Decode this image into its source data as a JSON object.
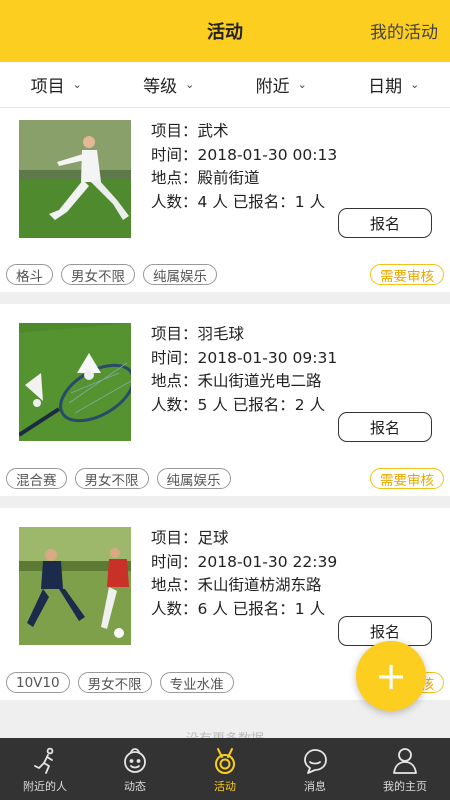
{
  "header": {
    "title": "活动",
    "my_activity": "我的活动"
  },
  "filters": [
    "项目",
    "等级",
    "附近",
    "日期"
  ],
  "info_labels": {
    "project": "项目：",
    "time": "时间：",
    "place": "地点：",
    "people": "人数：",
    "people_unit": " 人",
    "signed": " 已报名："
  },
  "signup_label": "报名",
  "review_label": "需要审核",
  "activities": [
    {
      "project": "武术",
      "time": "2018-01-30 00:13",
      "place": "殿前街道",
      "count": "4",
      "signed": "1",
      "tags": [
        "格斗",
        "男女不限",
        "纯属娱乐"
      ]
    },
    {
      "project": "羽毛球",
      "time": "2018-01-30 09:31",
      "place": "禾山街道光电二路",
      "count": "5",
      "signed": "2",
      "tags": [
        "混合赛",
        "男女不限",
        "纯属娱乐"
      ]
    },
    {
      "project": "足球",
      "time": "2018-01-30 22:39",
      "place": "禾山街道枋湖东路",
      "count": "6",
      "signed": "1",
      "tags": [
        "10V10",
        "男女不限",
        "专业水准"
      ]
    }
  ],
  "no_more": "没有更多数据",
  "fab": "+",
  "tabs": [
    {
      "label": "附近的人",
      "icon": "runner-icon"
    },
    {
      "label": "动态",
      "icon": "face-icon"
    },
    {
      "label": "活动",
      "icon": "medal-icon",
      "active": true
    },
    {
      "label": "消息",
      "icon": "chat-bubble-icon"
    },
    {
      "label": "我的主页",
      "icon": "person-icon"
    }
  ],
  "colors": {
    "accent": "#fcce1f",
    "review": "#e8a800",
    "tabbar": "#333333"
  }
}
